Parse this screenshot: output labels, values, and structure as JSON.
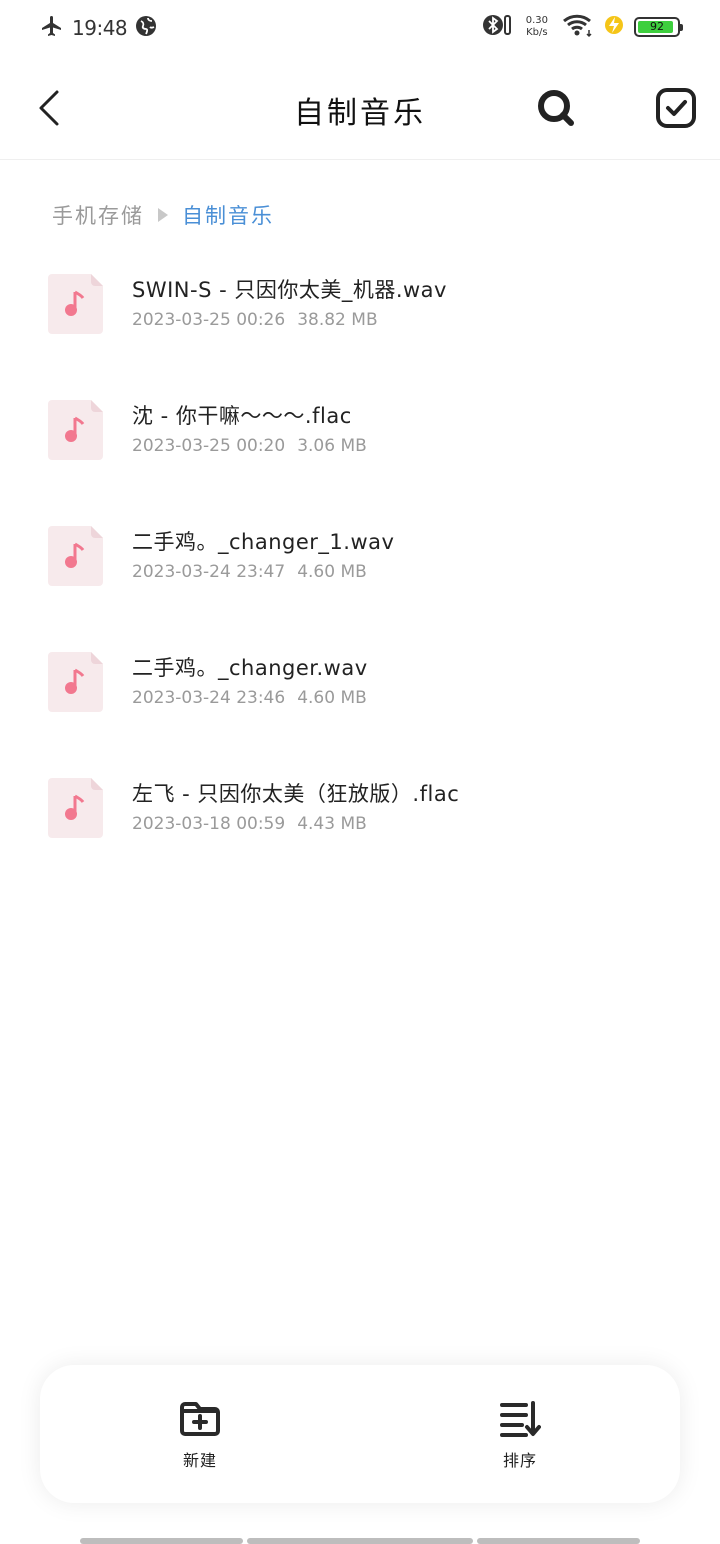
{
  "status_bar": {
    "time": "19:48",
    "net_speed_value": "0.30",
    "net_speed_unit": "Kb/s",
    "battery": "92",
    "battery_level": 0.92
  },
  "header": {
    "title": "自制音乐"
  },
  "breadcrumb": {
    "root": "手机存储",
    "current": "自制音乐"
  },
  "files": [
    {
      "name": "SWIN-S - 只因你太美_机器.wav",
      "date": "2023-03-25 00:26",
      "size": "38.82 MB"
    },
    {
      "name": "沈 - 你干嘛～～～.flac",
      "date": "2023-03-25 00:20",
      "size": "3.06 MB"
    },
    {
      "name": "二手鸡。_changer_1.wav",
      "date": "2023-03-24 23:47",
      "size": "4.60 MB"
    },
    {
      "name": "二手鸡。_changer.wav",
      "date": "2023-03-24 23:46",
      "size": "4.60 MB"
    },
    {
      "name": "左飞 - 只因你太美（狂放版）.flac",
      "date": "2023-03-18 00:59",
      "size": "4.43 MB"
    }
  ],
  "toolbar": {
    "new_label": "新建",
    "sort_label": "排序"
  },
  "colors": {
    "accent": "#4a8fd6",
    "music_icon": "#f2788f",
    "battery": "#3ecf3e"
  }
}
